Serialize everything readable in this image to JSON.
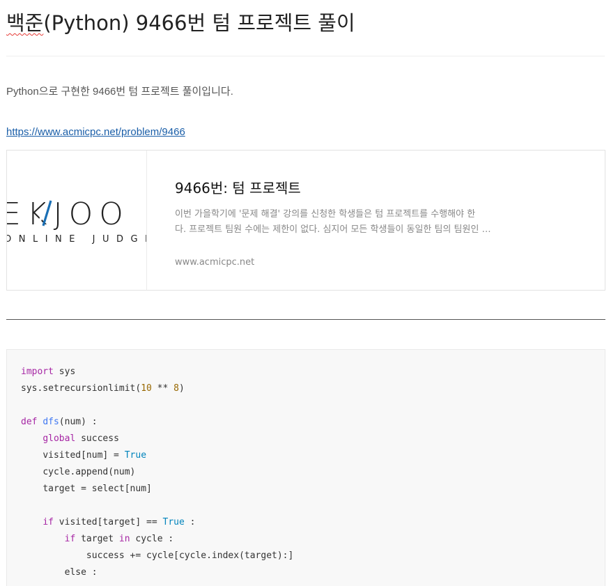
{
  "post": {
    "title_prefix": "백준",
    "title_rest": "(Python) 9466번 텀 프로젝트 풀이",
    "intro": "Python으로 구현한 9466번 텀 프로젝트 풀이입니다.",
    "link": "https://www.acmicpc.net/problem/9466"
  },
  "card": {
    "thumb_big_text": "EKJOO",
    "thumb_small_text": "ONLINE JUDGE",
    "title": "9466번: 텀 프로젝트",
    "desc_line1": "이번 가을학기에 '문제 해결' 강의를 신청한 학생들은 텀 프로젝트를 수행해야 한",
    "desc_line2": "다. 프로젝트 팀원 수에는 제한이 없다. 심지어 모든 학생들이 동일한 팀의 팀원인 경우와 같이 한 팀만 있을 수도 있다.",
    "domain": "www.acmicpc.net"
  },
  "code": {
    "l1_kw": "import",
    "l1_rest": " sys",
    "l2_a": "sys.setrecursionlimit(",
    "l2_n1": "10",
    "l2_op": " ** ",
    "l2_n2": "8",
    "l2_close": ")",
    "l4_kw": "def",
    "l4_fn": "dfs",
    "l4_rest": "(num) :",
    "l5_kw": "global",
    "l5_rest": " success",
    "l6_a": "visited[num] = ",
    "l6_lit": "True",
    "l7": "cycle.append(num)",
    "l8": "target = select[num]",
    "l10_kw": "if",
    "l10_a": " visited[target] == ",
    "l10_lit": "True",
    "l10_b": " :",
    "l11_kw": "if",
    "l11_a": " target ",
    "l11_kw2": "in",
    "l11_b": " cycle :",
    "l12": "success += cycle[cycle.index(target):]",
    "l13": "else :"
  }
}
